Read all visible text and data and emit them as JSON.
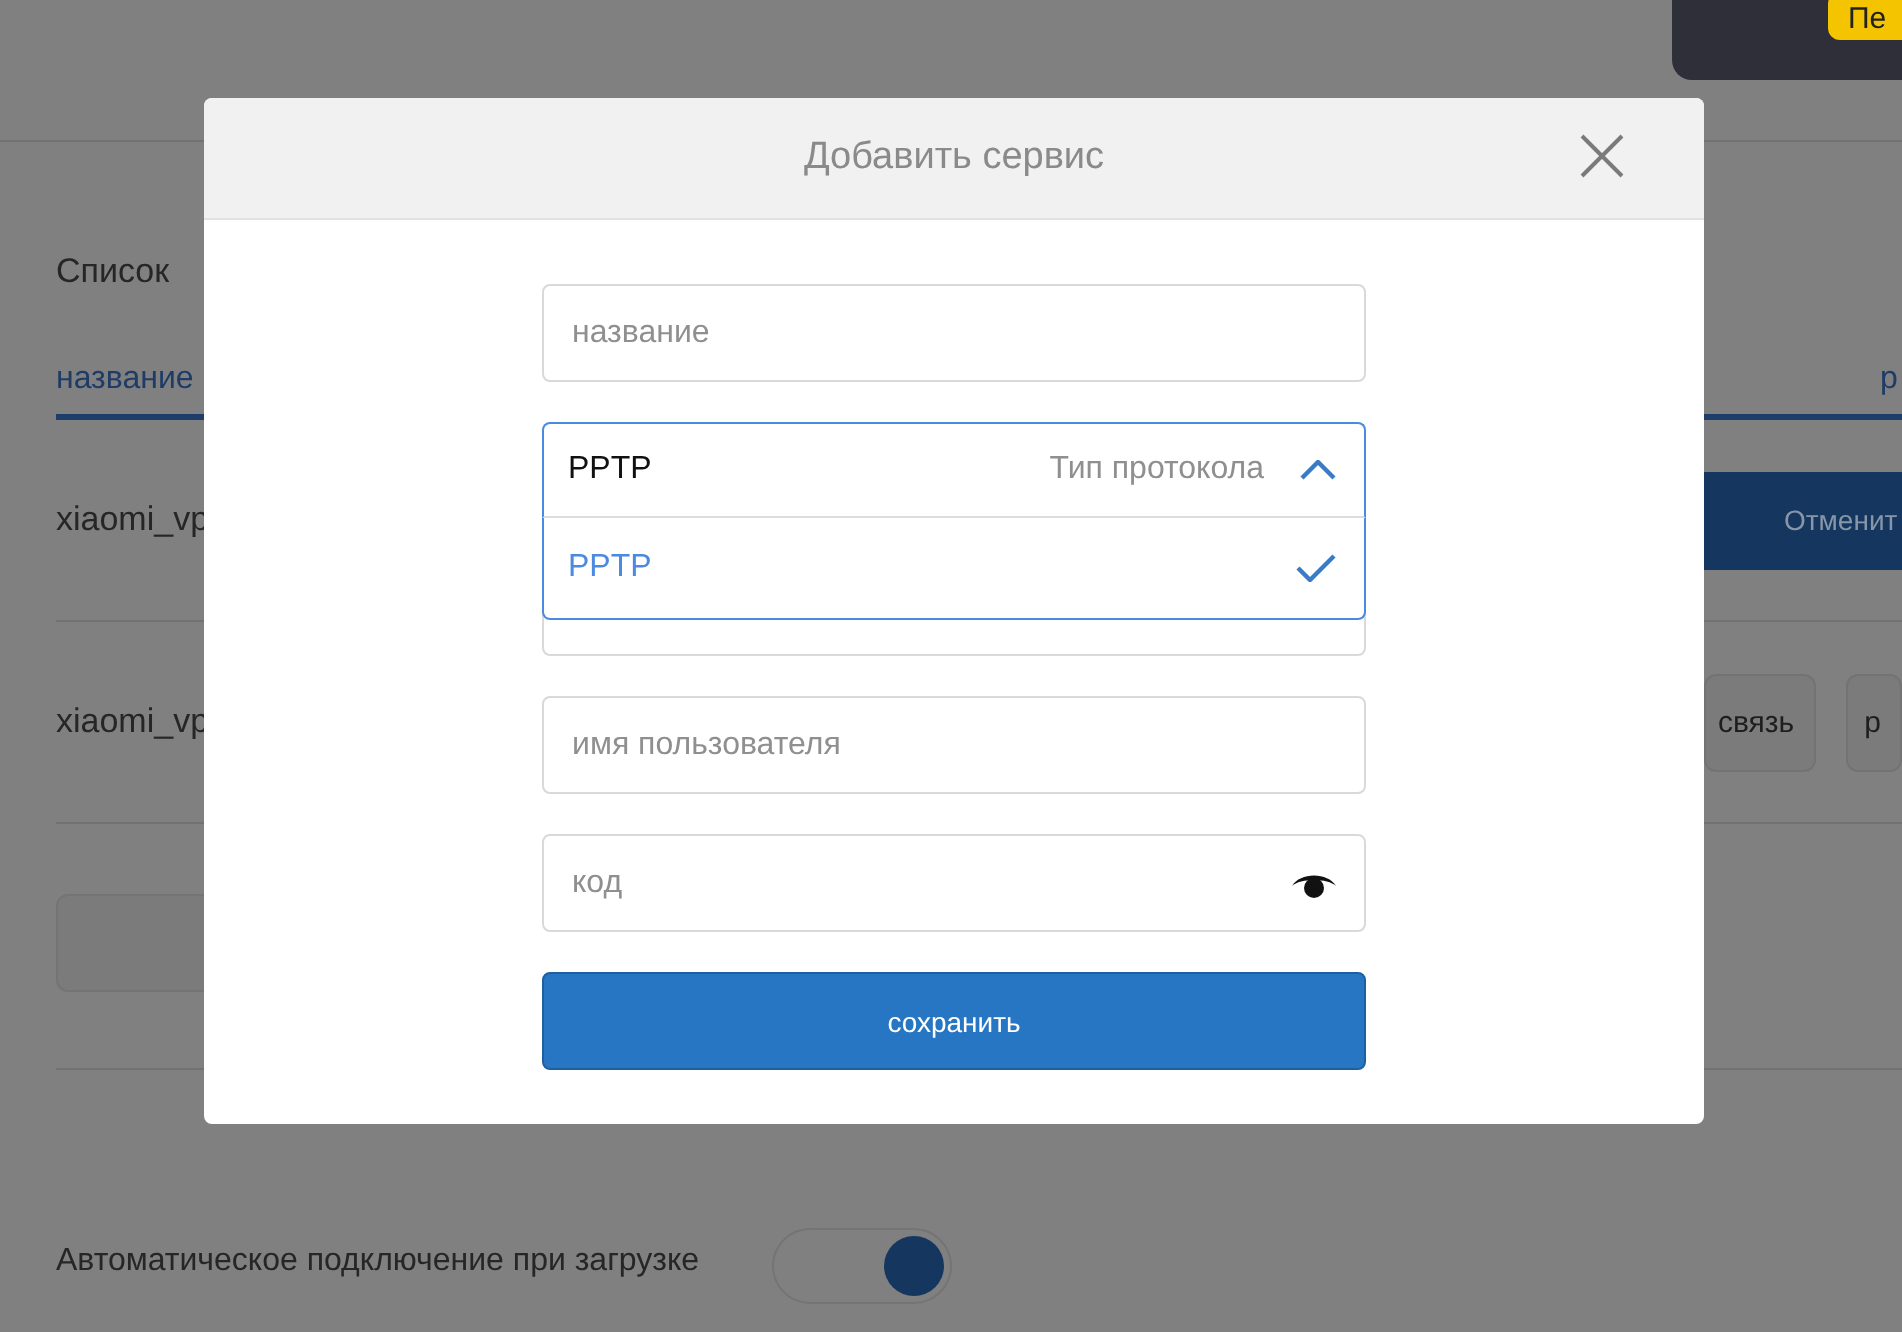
{
  "background": {
    "top_popup": {
      "button": "Пе"
    },
    "heading": "Список",
    "tabs": [
      {
        "label": "название",
        "selected": true
      },
      {
        "label": "р",
        "selected": true
      }
    ],
    "rows": [
      {
        "name": "xiaomi_vp",
        "actions": [
          {
            "label": "Отменит",
            "kind": "primary"
          }
        ]
      },
      {
        "name": "xiaomi_vp",
        "actions": [
          {
            "label": "связь",
            "kind": "secondary"
          },
          {
            "label": "р",
            "kind": "secondary"
          }
        ]
      }
    ],
    "auto_connect": {
      "label": "Автоматическое подключение при загрузке",
      "on": true
    }
  },
  "dialog": {
    "title": "Добавить сервис",
    "fields": [
      {
        "kind": "text",
        "placeholder": "название"
      },
      {
        "kind": "select",
        "value": "PPTP",
        "label": "Тип протокола",
        "expanded": true,
        "options": [
          {
            "label": "PPTP",
            "selected": true
          }
        ]
      },
      {
        "kind": "text"
      },
      {
        "kind": "text",
        "placeholder": "имя пользователя"
      },
      {
        "kind": "password",
        "placeholder": "код"
      }
    ],
    "save_button": "сохранить"
  }
}
